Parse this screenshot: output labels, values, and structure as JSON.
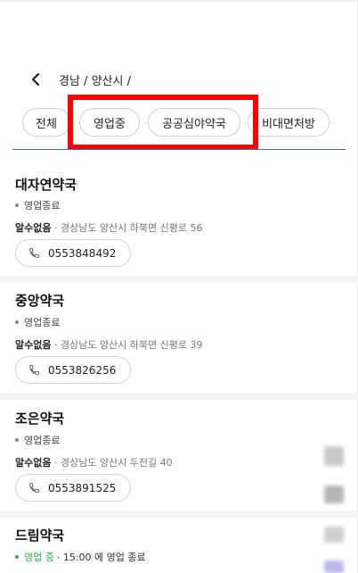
{
  "header": {
    "back_icon": "chevron-left-icon",
    "breadcrumb": "경남 / 양산시 /"
  },
  "filters": [
    {
      "label": "전체"
    },
    {
      "label": "영업중"
    },
    {
      "label": "공공심야약국"
    },
    {
      "label": "비대면처방"
    }
  ],
  "pharmacies": [
    {
      "name": "대자연약국",
      "status": "영업종료",
      "status_note": "",
      "address_prefix": "알수없음",
      "address": "· 경상남도 양산시 하북면 신평로 56",
      "phone": "0553848492"
    },
    {
      "name": "중앙약국",
      "status": "영업종료",
      "status_note": "",
      "address_prefix": "알수없음",
      "address": "· 경상남도 양산시 하북면 신평로 39",
      "phone": "0553826256"
    },
    {
      "name": "조은약국",
      "status": "영업종료",
      "status_note": "",
      "address_prefix": "알수없음",
      "address": "· 경상남도 양산시 두전길 40",
      "phone": "0553891525"
    },
    {
      "name": "드림약국",
      "status": "영업 중",
      "status_note": "· 15:00 에 영업 종료"
    }
  ],
  "colors": {
    "highlight": "#ff0000",
    "open_status": "#2bb24c",
    "tab_underline": "#3b6fd8"
  }
}
